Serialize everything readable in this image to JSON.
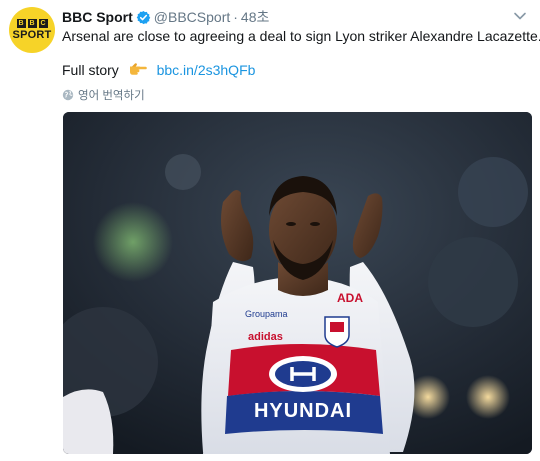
{
  "tweet": {
    "author_name": "BBC Sport",
    "handle": "@BBCSport",
    "separator": "·",
    "time": "48초",
    "text": "Arsenal are close to agreeing a deal to sign Lyon striker Alexandre Lacazette.",
    "story_label": "Full story",
    "story_emoji_icon": "pointing-hand-icon",
    "link": "bbc.in/2s3hQFb",
    "translate_label": "영어 번역하기"
  },
  "avatar": {
    "bbc_letters": [
      "B",
      "B",
      "C"
    ],
    "word": "SPORT"
  },
  "photo": {
    "sponsor": "HYUNDAI",
    "sleeve_text": "Groupama",
    "chest_brand": "adidas",
    "ada_text": "ADA"
  },
  "colors": {
    "link": "#1b95e0",
    "muted": "#657786",
    "verified": "#1da1f2",
    "avatar_bg": "#f6d328",
    "jersey_red": "#c8102e",
    "jersey_blue": "#1f3b8f"
  }
}
